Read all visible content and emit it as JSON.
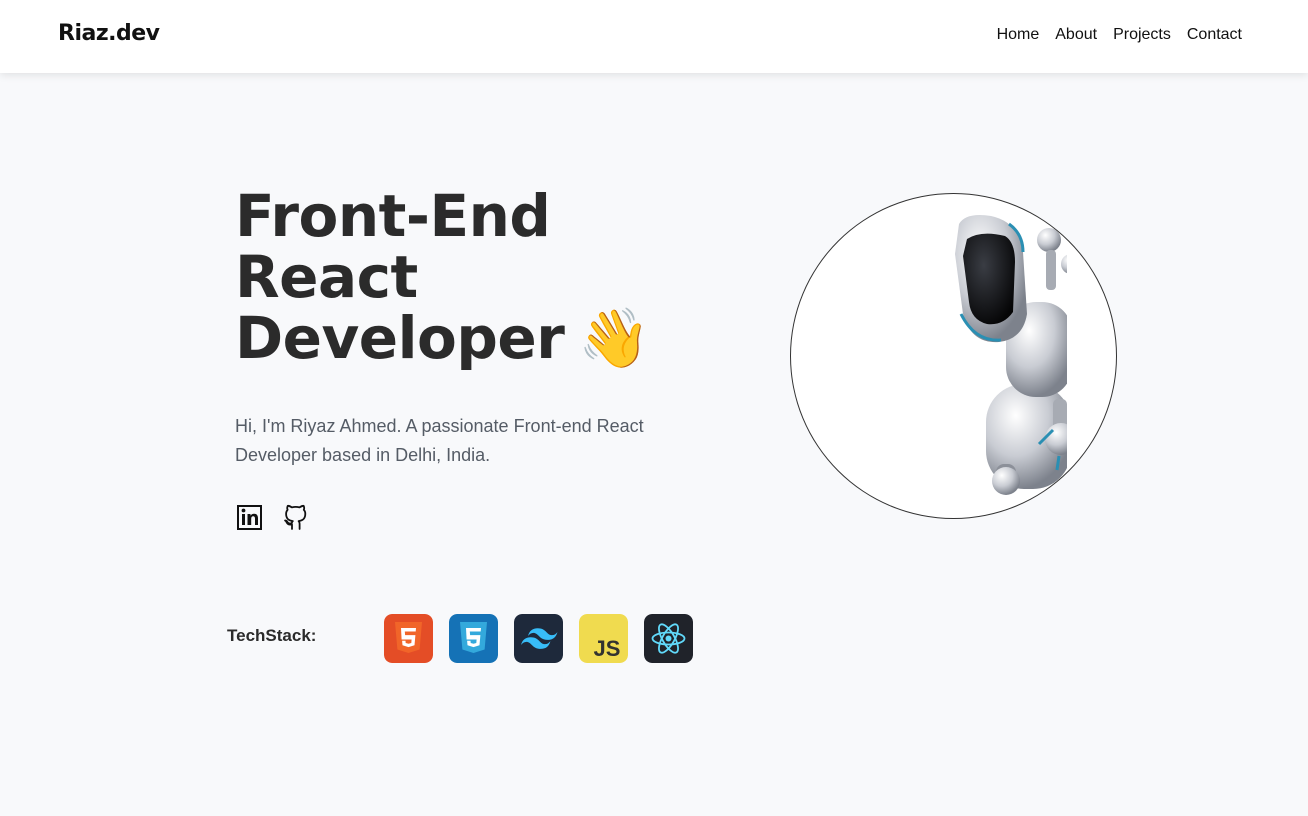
{
  "header": {
    "brand": "Riaz.dev",
    "nav": [
      {
        "label": "Home"
      },
      {
        "label": "About"
      },
      {
        "label": "Projects"
      },
      {
        "label": "Contact"
      }
    ]
  },
  "hero": {
    "title_lines": [
      "Front-End",
      "React",
      "Developer"
    ],
    "wave_emoji": "👋",
    "description": "Hi, I'm Riyaz Ahmed. A passionate Front-end React Developer based in Delhi, India.",
    "socials": [
      {
        "icon": "linkedin-icon"
      },
      {
        "icon": "github-icon"
      }
    ],
    "image_icon": "robot-illustration"
  },
  "techstack": {
    "label": "TechStack:",
    "items": [
      {
        "icon": "html5-icon",
        "color": "#e44d26"
      },
      {
        "icon": "css3-icon",
        "color": "#1572b6"
      },
      {
        "icon": "tailwind-icon",
        "color": "#1e293b"
      },
      {
        "icon": "javascript-icon",
        "color": "#f0db4f",
        "text": "JS"
      },
      {
        "icon": "react-icon",
        "color": "#20232a"
      }
    ]
  },
  "colors": {
    "background": "#f8f9fb",
    "header": "#ffffff",
    "title": "#2b2b2b",
    "body_text": "#555c66"
  }
}
